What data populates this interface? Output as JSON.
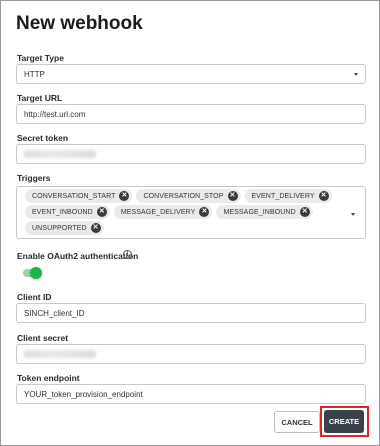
{
  "dialog": {
    "title": "New webhook"
  },
  "target_type": {
    "label": "Target Type",
    "value": "HTTP"
  },
  "target_url": {
    "label": "Target URL",
    "value": "http://test.url.com"
  },
  "secret_token": {
    "label": "Secret token"
  },
  "triggers": {
    "label": "Triggers",
    "chips": [
      "CONVERSATION_START",
      "CONVERSATION_STOP",
      "EVENT_DELIVERY",
      "EVENT_INBOUND",
      "MESSAGE_DELIVERY",
      "MESSAGE_INBOUND",
      "UNSUPPORTED"
    ]
  },
  "oauth": {
    "label": "Enable OAuth2 authentication",
    "enabled": true,
    "info_icon": "info-icon"
  },
  "client_id": {
    "label": "Client ID",
    "value": "SINCH_client_ID"
  },
  "client_secret": {
    "label": "Client secret"
  },
  "token_endpoint": {
    "label": "Token endpoint",
    "value": "YOUR_token_provision_endpoint"
  },
  "actions": {
    "cancel_label": "CANCEL",
    "create_label": "CREATE"
  },
  "colors": {
    "toggle_on": "#22b14c",
    "create_button_bg": "#3b4148",
    "highlight": "#e3232c"
  }
}
